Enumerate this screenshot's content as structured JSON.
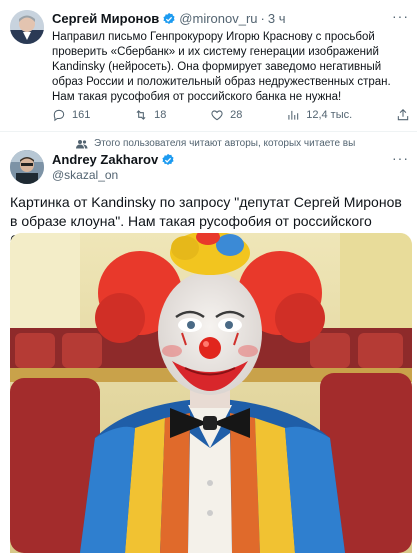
{
  "tweet1": {
    "author_name": "Сергей Миронов",
    "handle": "@mironov_ru",
    "separator": "·",
    "time": "3 ч",
    "more": "···",
    "text": "Направил письмо Генпрокурору Игорю Краснову с просьбой проверить «Сбербанк» и их систему генерации изображений Kandinsky (нейросеть). Она формирует заведомо негативный образ России и положительный образ недружественных стран. Нам такая русофобия от российского банка не нужна!",
    "replies": "161",
    "retweets": "18",
    "likes": "28",
    "views": "12,4 тыс."
  },
  "followed_note": "Этого пользователя читают авторы, которых читаете вы",
  "tweet2": {
    "author_name": "Andrey Zakharov",
    "handle": "@skazal_on",
    "more": "···",
    "text": "Картинка от Kandinsky по запросу \"депутат Сергей Миронов в образе клоуна\". Нам такая русофобия от российского банка не нужна!"
  },
  "colors": {
    "verified": "#1d9bf0",
    "text": "#0f1419",
    "secondary": "#536471"
  },
  "icons": {
    "reply": "reply-icon",
    "retweet": "retweet-icon",
    "like": "heart-icon",
    "views": "views-icon",
    "share": "share-icon"
  }
}
